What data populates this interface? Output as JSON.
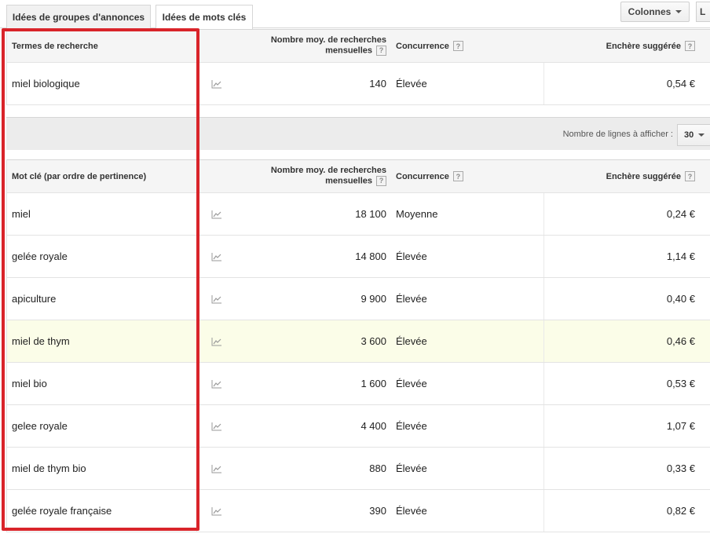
{
  "tabs": [
    {
      "label": "Idées de groupes d'annonces"
    },
    {
      "label": "Idées de mots clés"
    }
  ],
  "toolbar": {
    "columns_label": "Colonnes",
    "edge_label": "L"
  },
  "search_terms": {
    "header": {
      "term": "Termes de recherche",
      "volume_line1": "Nombre moy. de recherches",
      "volume_line2": "mensuelles",
      "competition": "Concurrence",
      "bid": "Enchère suggérée",
      "help": "?"
    },
    "rows": [
      {
        "term": "miel biologique",
        "volume": "140",
        "competition": "Élevée",
        "bid": "0,54 €"
      }
    ]
  },
  "pagination": {
    "rows_label": "Nombre de lignes à afficher :",
    "rows_value": "30"
  },
  "keywords": {
    "header": {
      "term": "Mot clé (par ordre de pertinence)",
      "volume_line1": "Nombre moy. de recherches",
      "volume_line2": "mensuelles",
      "competition": "Concurrence",
      "bid": "Enchère suggérée",
      "help": "?"
    },
    "rows": [
      {
        "term": "miel",
        "volume": "18 100",
        "competition": "Moyenne",
        "bid": "0,24 €"
      },
      {
        "term": "gelée royale",
        "volume": "14 800",
        "competition": "Élevée",
        "bid": "1,14 €"
      },
      {
        "term": "apiculture",
        "volume": "9 900",
        "competition": "Élevée",
        "bid": "0,40 €"
      },
      {
        "term": "miel de thym",
        "volume": "3 600",
        "competition": "Élevée",
        "bid": "0,46 €"
      },
      {
        "term": "miel bio",
        "volume": "1 600",
        "competition": "Élevée",
        "bid": "0,53 €"
      },
      {
        "term": "gelee royale",
        "volume": "4 400",
        "competition": "Élevée",
        "bid": "1,07 €"
      },
      {
        "term": "miel de thym bio",
        "volume": "880",
        "competition": "Élevée",
        "bid": "0,33 €"
      },
      {
        "term": "gelée royale française",
        "volume": "390",
        "competition": "Élevée",
        "bid": "0,82 €"
      }
    ]
  },
  "colors": {
    "highlight_row": "#fbfde8",
    "annotation": "#d9242a"
  },
  "icons": {
    "trend": "trend-chart-icon",
    "help": "help-icon",
    "dropdown": "chevron-down-icon"
  }
}
